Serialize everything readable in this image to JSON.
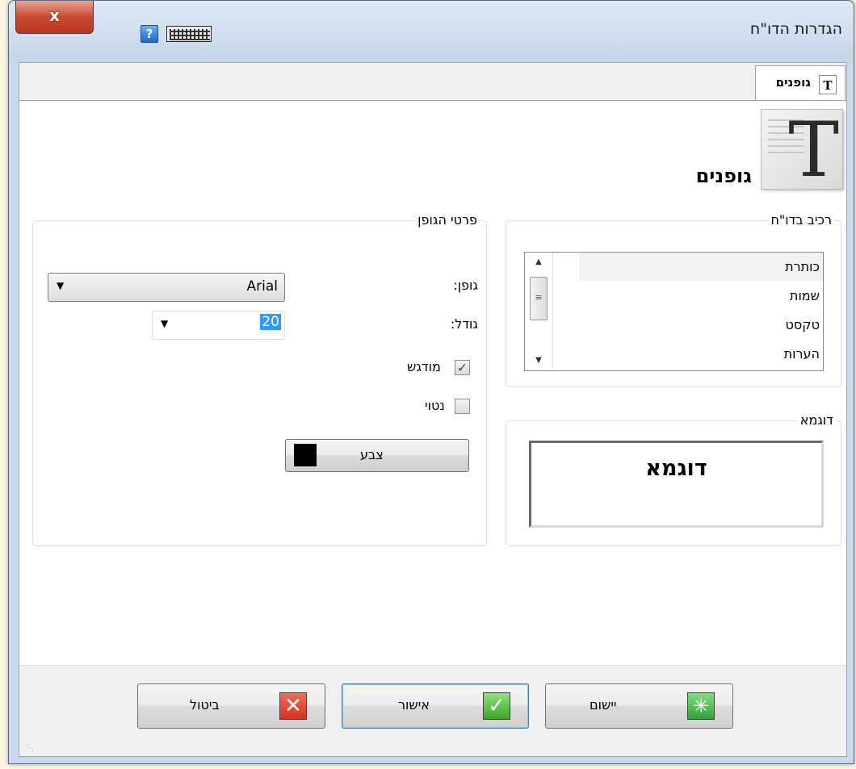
{
  "window": {
    "title": "הגדרות הדו\"ח",
    "close_label": "x",
    "help_label": "?",
    "help_icon": "help-icon",
    "keyboard_icon": "keyboard-icon"
  },
  "tabs": [
    {
      "label": "גופנים",
      "icon": "font-icon",
      "active": true
    }
  ],
  "header": {
    "title": "גופנים",
    "icon_glyph": "T"
  },
  "report_component": {
    "legend": "רכיב בדו\"ח",
    "items": [
      "כותרת",
      "שמות",
      "טקסט",
      "הערות"
    ],
    "selected_index": 0
  },
  "sample": {
    "legend": "דוגמא",
    "text": "דוגמא"
  },
  "font_details": {
    "legend": "פרטי הגופן",
    "font_label": "גופן:",
    "font_value": "Arial",
    "size_label": "גודל:",
    "size_value": "20",
    "bold_label": "מודגש",
    "bold_checked": true,
    "italic_label": "נטוי",
    "italic_checked": false,
    "color_label": "צבע",
    "color_value": "#000000"
  },
  "footer": {
    "cancel_label": "ביטול",
    "ok_label": "אישור",
    "apply_label": "יישום"
  }
}
